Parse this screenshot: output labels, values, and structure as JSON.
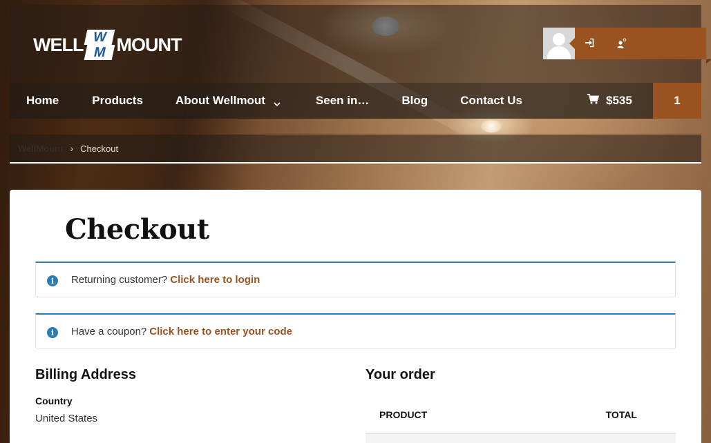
{
  "brand": {
    "logo_left": "WELL",
    "logo_mark_top": "W",
    "logo_mark_bottom": "M",
    "logo_right": "MOUNT",
    "accent_color": "#9a5221",
    "info_color": "#2c7cb8"
  },
  "user_box": {
    "avatar_icon": "user-avatar-icon",
    "login_icon": "sign-in-icon",
    "register_icon": "user-plus-icon"
  },
  "nav": {
    "items": [
      {
        "label": "Home"
      },
      {
        "label": "Products"
      },
      {
        "label": "About Wellmout",
        "has_dropdown": true
      },
      {
        "label": "Seen in…"
      },
      {
        "label": "Blog"
      },
      {
        "label": "Contact Us"
      }
    ],
    "cart_icon": "shopping-cart-icon",
    "cart_total": "$535",
    "cart_count": "1"
  },
  "breadcrumb": {
    "home": "WellMount",
    "separator": "›",
    "current": "Checkout"
  },
  "page": {
    "title": "Checkout",
    "returning_text": "Returning customer?",
    "returning_link": "Click here to login",
    "coupon_text": "Have a coupon?",
    "coupon_link": "Click here to enter your code",
    "info_icon_glyph": "i"
  },
  "billing": {
    "title": "Billing Address",
    "country_label": "Country",
    "country_value": "United States"
  },
  "order": {
    "title": "Your order",
    "columns": [
      "PRODUCT",
      "TOTAL"
    ]
  }
}
